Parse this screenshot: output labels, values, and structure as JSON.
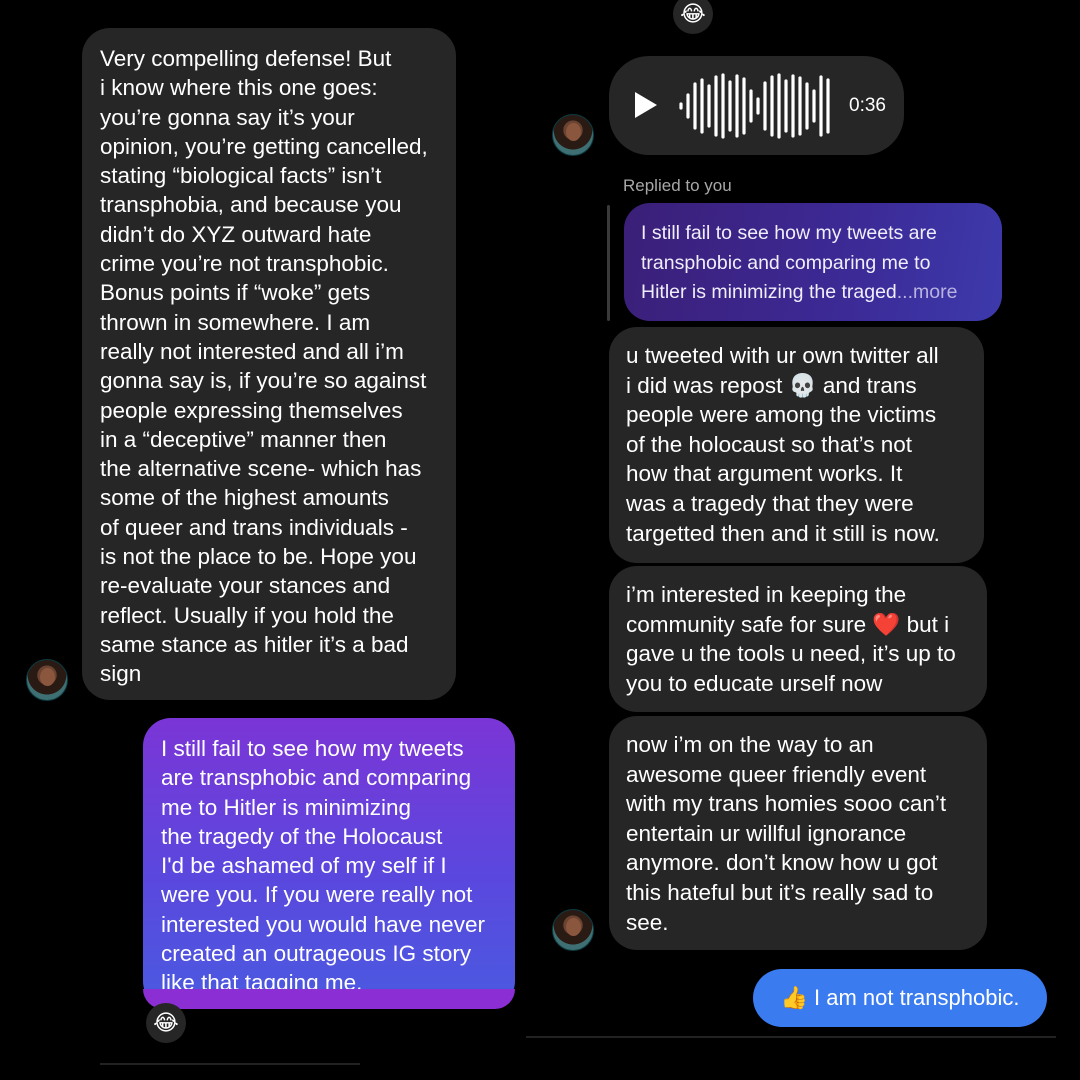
{
  "left_column": {
    "incoming_message": "Very compelling defense! But\ni know where this one goes:\nyou’re gonna say it’s your\nopinion, you’re getting cancelled,\nstating “biological facts” isn’t\ntransphobia, and because you\ndidn’t do XYZ outward hate\ncrime you’re not transphobic.\nBonus points if “woke” gets\nthrown in somewhere. I am\nreally not interested and all i’m\ngonna say is, if you’re so against\npeople expressing themselves\nin a “deceptive” manner then\nthe alternative scene- which has\nsome of the highest amounts\nof queer and trans individuals -\nis not the place to be. Hope you\nre-evaluate your stances and\nreflect. Usually if you hold the\nsame stance as hitler it’s a bad\nsign",
    "outgoing_message": "I still fail to see how my tweets\nare transphobic and comparing\nme to Hitler is minimizing\nthe tragedy of the Holocaust\nI'd be ashamed of my self if I\nwere you. If you were really not\ninterested you would have never\ncreated an outrageous IG story\nlike that tagging me.",
    "reaction_emoji": "😂"
  },
  "right_column": {
    "top_reaction_emoji": "😂",
    "voice_message": {
      "duration": "0:36"
    },
    "replied_label": "Replied to you",
    "quoted_message": "I still fail to see how my tweets are\ntransphobic and comparing me to\nHitler is minimizing the traged",
    "quoted_more": "...more",
    "messages": [
      "u tweeted with ur own twitter all\ni did was repost 💀 and trans\npeople were among the victims\nof the holocaust so that’s not\nhow that argument works. It\nwas a tragedy that they were\ntargetted then and it still is now.",
      "i’m interested in keeping the\ncommunity safe for sure ❤️ but i\ngave u the tools u need, it’s up to\nyou to educate urself now",
      "now i’m on the way to an\nawesome queer friendly event\nwith my trans homies sooo can’t\nentertain ur willful ignorance\nanymore. don’t know how u got\nthis hateful but it’s really sad to\nsee."
    ],
    "outgoing_message": "👍 I am not transphobic."
  },
  "colors": {
    "background": "#000000",
    "incoming_bubble": "#262626",
    "outgoing_gradient_top": "#7b35d6",
    "outgoing_gradient_bottom": "#4a5ae0",
    "sent_bubble_blue": "#3a7bf0"
  },
  "icons": [
    "play-icon",
    "waveform-icon",
    "avatar-icon",
    "laughing-emoji-icon"
  ]
}
